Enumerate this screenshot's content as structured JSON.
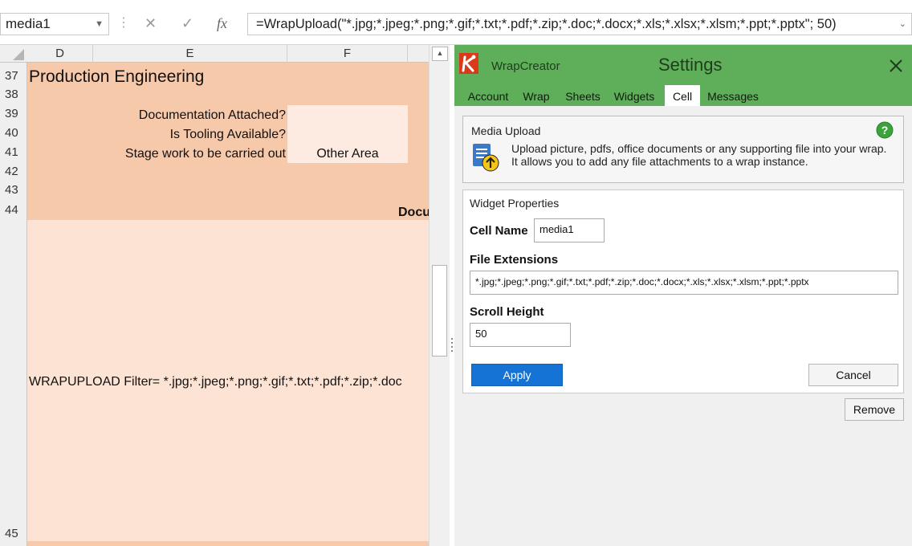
{
  "formula_bar": {
    "name_box": "media1",
    "cancel_glyph": "✕",
    "enter_glyph": "✓",
    "fx_glyph": "fx",
    "formula": "=WrapUpload(\"*.jpg;*.jpeg;*.png;*.gif;*.txt;*.pdf;*.zip;*.doc;*.docx;*.xls;*.xlsx;*.xlsm;*.ppt;*.pptx\"; 50)"
  },
  "sheet": {
    "columns": [
      "D",
      "E",
      "F"
    ],
    "rows": [
      "37",
      "38",
      "39",
      "40",
      "41",
      "42",
      "43",
      "44",
      "45"
    ],
    "section_title": "Production Engineering",
    "labels": {
      "documentation": "Documentation Attached?",
      "tooling": "Is Tooling Available?",
      "stage": "Stage work to be carried out"
    },
    "stage_value": "Other Area",
    "row44_text": "Docu",
    "row45_text": "WRAPUPLOAD  Filter= *.jpg;*.jpeg;*.png;*.gif;*.txt;*.pdf;*.zip;*.doc",
    "colors": {
      "section_bg": "#f7c9ab",
      "cell_bg": "#fde3d4",
      "input_bg": "#fdeae0"
    }
  },
  "panel": {
    "app_name": "WrapCreator",
    "title": "Settings",
    "tabs": [
      "Account",
      "Wrap",
      "Sheets",
      "Widgets",
      "Cell",
      "Messages"
    ],
    "active_tab": "Cell",
    "info": {
      "title": "Media Upload",
      "text": "Upload picture, pdfs, office documents or any supporting file into your wrap. It allows you to add any file attachments to a wrap instance."
    },
    "widget_properties": {
      "heading": "Widget Properties",
      "cell_name_label": "Cell Name",
      "cell_name_value": "media1",
      "file_ext_label": "File Extensions",
      "file_ext_value": "*.jpg;*.jpeg;*.png;*.gif;*.txt;*.pdf;*.zip;*.doc;*.docx;*.xls;*.xlsx;*.xlsm;*.ppt;*.pptx",
      "scroll_height_label": "Scroll Height",
      "scroll_height_value": "50",
      "apply_label": "Apply",
      "cancel_label": "Cancel"
    },
    "remove_label": "Remove",
    "colors": {
      "header_green": "#5fae5a",
      "apply_blue": "#1673d6",
      "help_green": "#3aa33a"
    }
  },
  "icons": [
    "dropdown-chevron-icon",
    "cancel-icon",
    "enter-icon",
    "fx-icon",
    "wrapcreator-logo",
    "close-icon",
    "help-icon",
    "media-upload-icon"
  ]
}
